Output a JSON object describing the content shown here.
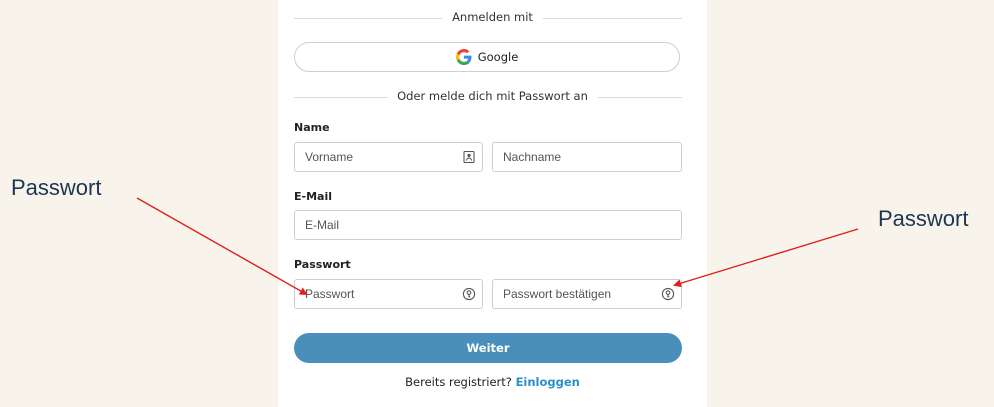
{
  "form": {
    "signin_with_label": "Anmelden mit",
    "google_label": "Google",
    "password_divider_label": "Oder melde dich mit Passwort an",
    "name_label": "Name",
    "firstname_placeholder": "Vorname",
    "lastname_placeholder": "Nachname",
    "email_label": "E-Mail",
    "email_placeholder": "E-Mail",
    "password_label": "Passwort",
    "password_placeholder": "Passwort",
    "password_confirm_placeholder": "Passwort bestätigen",
    "continue_label": "Weiter",
    "already_registered_text": "Bereits registriert?",
    "login_link_label": "Einloggen"
  },
  "annotations": {
    "left_label": "Passwort",
    "right_label": "Passwort",
    "arrow_color": "#e0201c"
  },
  "colors": {
    "background": "#f8f4ec",
    "primary_button": "#4a8fbc",
    "link": "#2d8fc7"
  }
}
